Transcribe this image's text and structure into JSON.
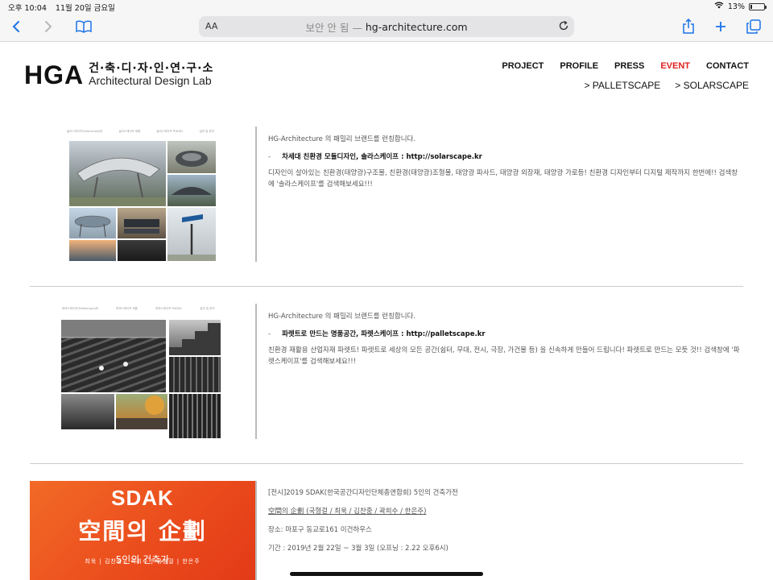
{
  "status_bar": {
    "time": "오후 10:04",
    "date": "11월 20일 금요일",
    "battery": "13%",
    "battery_level": 0.13
  },
  "browser": {
    "aa_label": "AA",
    "insecure_label": "보안 안 됨 —",
    "url": "hg-architecture.com"
  },
  "site": {
    "logo_main": "HGA",
    "logo_ko": "건·축·디·자·인·연·구·소",
    "logo_en": "Architectural Design Lab",
    "nav": [
      "PROJECT",
      "PROFILE",
      "PRESS",
      "EVENT",
      "CONTACT"
    ],
    "active_nav": "EVENT",
    "subnav": [
      "> PALLETSCAPE",
      "> SOLARSCAPE"
    ]
  },
  "posts": [
    {
      "intro": "HG-Architecture 의  패밀리 브랜드를 런칭합니다.",
      "headline": "차세대 친환경 모듈디자인, 솔라스케이프 : http://solarscape.kr",
      "body": "디자인이 살아있는 친환경(태양광)구조물, 친환경(태양광)조형물, 태양광 파사드, 태양광 외장재, 태양광 가로등! 친환경 디자인부터 디지털 제작까지 한번에!! 검색창에 '솔라스케이프'를 검색해보세요!!!",
      "thumb_header": [
        "솔라스케이프(Solarscape)란",
        "솔라스케이프 제품",
        "솔라스케이프 프로세스",
        "설치 및 문의"
      ]
    },
    {
      "intro": "HG-Architecture 의  패밀리 브랜드를 런칭합니다.",
      "headline": "파렛트로 만드는 명품공간, 파렛스케이프 : http://palletscape.kr",
      "body": "친환경 재활용 산업자재 파렛트! 파렛트로 세상의 모든 공간(쉼터, 무대, 전시, 극장, 가건물 등) 을 신속하게 만들어 드립니다! 파렛트로 만드는 모듯 것!! 검색창에 '파렛스케이프'를 검색해보세요!!!",
      "thumb_header": [
        "파렛스케이프(Palletscape)란",
        "파렛스케이프 제품",
        "파렛스케이프 프로세스",
        "설치 및 문의"
      ]
    },
    {
      "line1": "[전시]2019 SDAK(한국공간디자인단체총연합회)  5인의 건축가전",
      "line2": "空間의 企劃 (국형걸 / 최욱 / 김찬중 / 곽희수 / 한은주)",
      "line3": "장소: 마포구 동교로161 이건하우스",
      "line4": "기간 : 2019년 2월 22일 ~ 3월 3일 (오프닝 : 2.22 오후6시)",
      "poster_title": "SDAK",
      "poster_hanja": "空間의 企劃",
      "poster_sub": "5인의 건축가",
      "poster_names": "최욱  |  김찬중  |  곽희수  |  국형걸  |  한은주"
    }
  ]
}
